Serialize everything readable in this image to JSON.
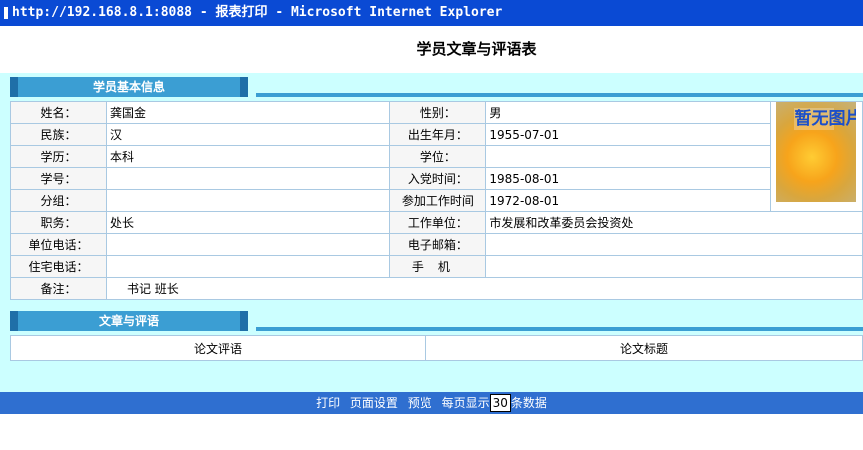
{
  "window": {
    "title": "http://192.168.8.1:8088 - 报表打印 - Microsoft Internet Explorer"
  },
  "page": {
    "title": "学员文章与评语表"
  },
  "sections": {
    "basic": "学员基本信息",
    "articles": "文章与评语"
  },
  "info": {
    "name_label": "姓名：",
    "name": "龚国金",
    "gender_label": "性别：",
    "gender": "男",
    "ethnicity_label": "民族：",
    "ethnicity": "汉",
    "birth_label": "出生年月：",
    "birth": "1955-07-01",
    "education_label": "学历：",
    "education": "本科",
    "degree_label": "学位：",
    "degree": "",
    "student_no_label": "学号：",
    "student_no": "",
    "party_date_label": "入党时间：",
    "party_date": "1985-08-01",
    "group_label": "分组：",
    "group": "",
    "work_date_label": "参加工作时间",
    "work_date": "1972-08-01",
    "position_label": "职务：",
    "position": "处长",
    "employer_label": "工作单位：",
    "employer": "市发展和改革委员会投资处",
    "office_phone_label": "单位电话：",
    "office_phone": "",
    "email_label": "电子邮箱：",
    "email": "",
    "home_phone_label": "住宅电话：",
    "home_phone": "",
    "mobile_label": "手机",
    "mobile": "",
    "remarks_label": "备注：",
    "remarks": "书记 班长"
  },
  "photo": {
    "text": "暂无图片"
  },
  "articles_table": {
    "columns": [
      "论文评语",
      "论文标题"
    ]
  },
  "footer": {
    "print": "打印",
    "page_setup": "页面设置",
    "preview": "预览",
    "per_page_prefix": "每页显示",
    "per_page_value": "30",
    "per_page_suffix": "条数据"
  }
}
